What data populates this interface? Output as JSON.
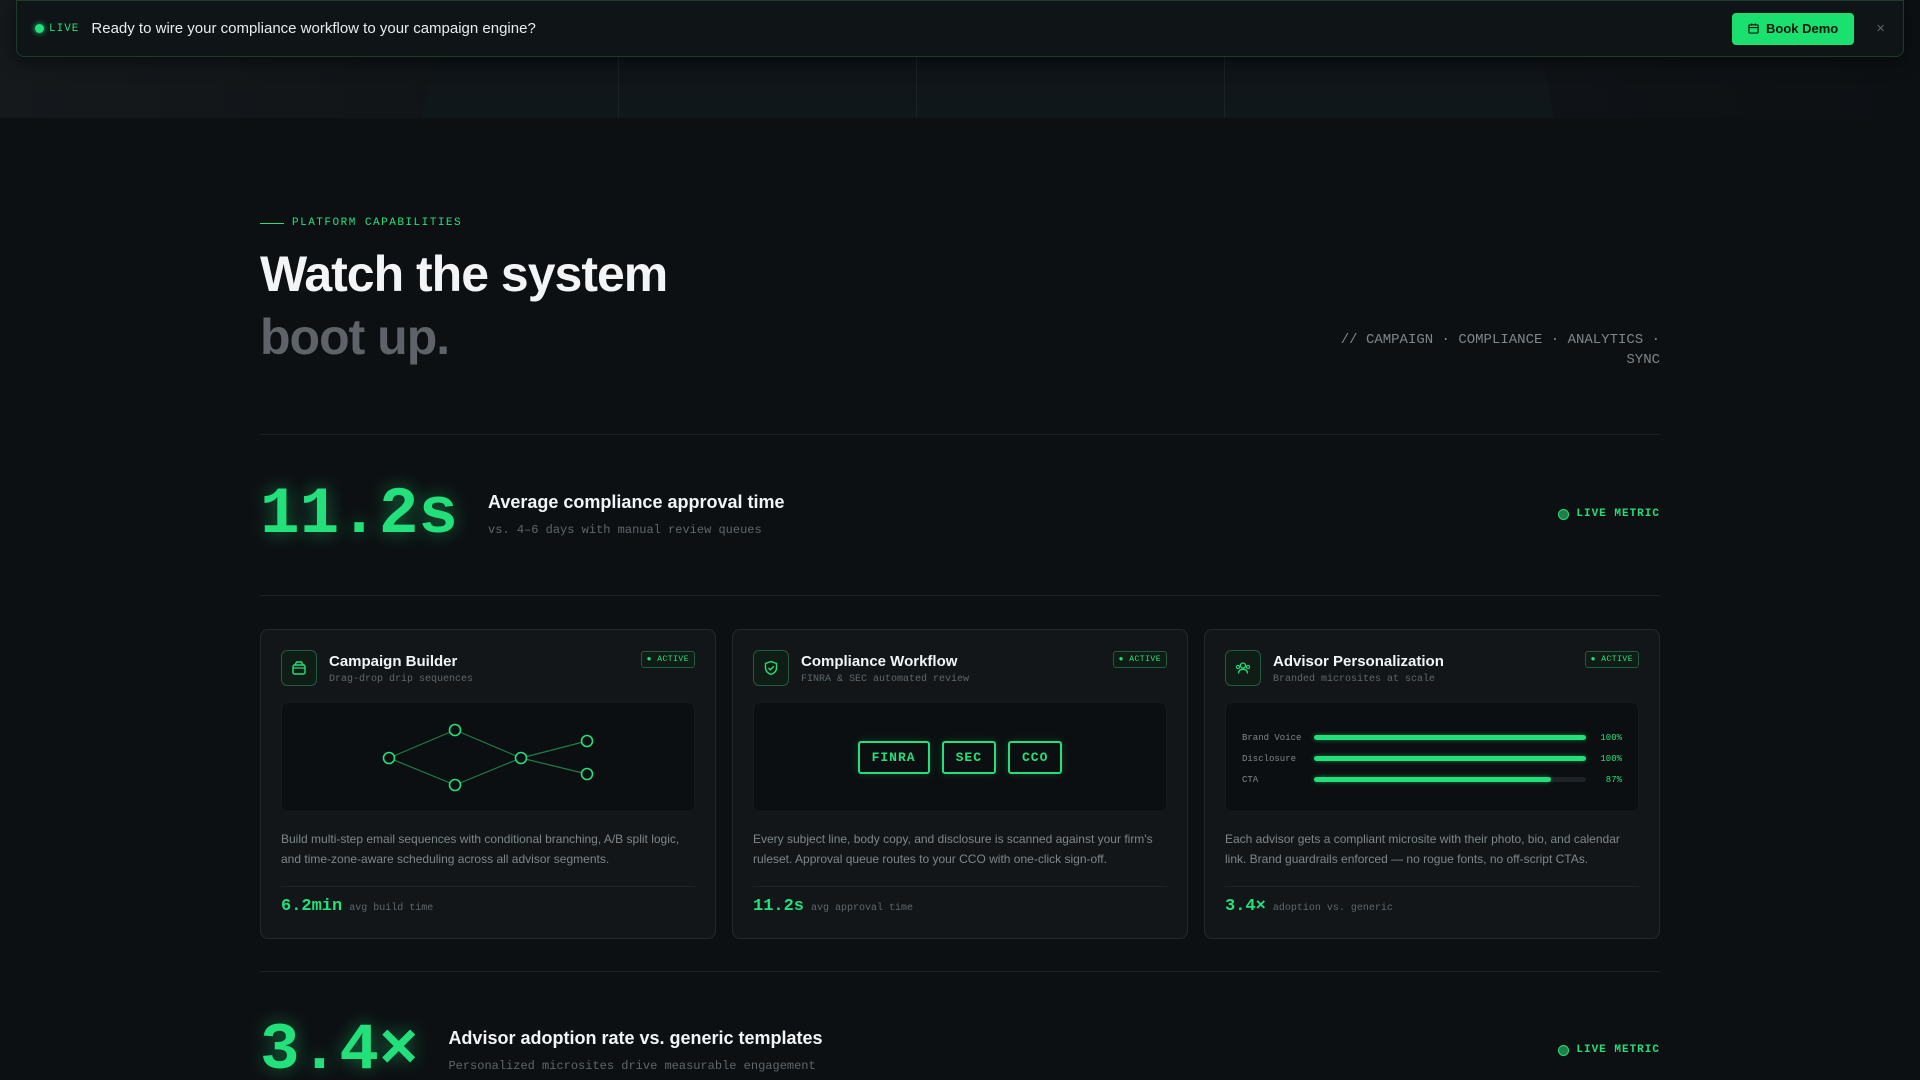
{
  "banner": {
    "live_label": "LIVE",
    "message": "Ready to wire your compliance workflow to your campaign engine?",
    "cta_label": "Book Demo",
    "close_glyph": "×"
  },
  "section": {
    "eyebrow": "PLATFORM CAPABILITIES",
    "title_line1": "Watch the system",
    "title_line2": "boot up.",
    "tagline": "// CAMPAIGN · COMPLIANCE · ANALYTICS · SYNC"
  },
  "metrics": [
    {
      "value": "11.2s",
      "title": "Average compliance approval time",
      "subtitle": "vs. 4–6 days with manual review queues",
      "live_label": "LIVE METRIC"
    },
    {
      "value": "3.4×",
      "title": "Advisor adoption rate vs. generic templates",
      "subtitle": "Personalized microsites drive measurable engagement",
      "live_label": "LIVE METRIC"
    }
  ],
  "cards": [
    {
      "icon": "box-icon",
      "title": "Campaign Builder",
      "subtitle": "Drag-drop drip sequences",
      "badge": "● ACTIVE",
      "description": "Build multi-step email sequences with conditional branching, A/B split logic, and time-zone-aware scheduling across all advisor segments.",
      "foot_value": "6.2min",
      "foot_label": "avg build time"
    },
    {
      "icon": "shield-check-icon",
      "title": "Compliance Workflow",
      "subtitle": "FINRA & SEC automated review",
      "badge": "● ACTIVE",
      "tags": [
        "FINRA",
        "SEC",
        "CCO"
      ],
      "description": "Every subject line, body copy, and disclosure is scanned against your firm's ruleset. Approval queue routes to your CCO with one-click sign-off.",
      "foot_value": "11.2s",
      "foot_label": "avg approval time"
    },
    {
      "icon": "users-icon",
      "title": "Advisor Personalization",
      "subtitle": "Branded microsites at scale",
      "badge": "● ACTIVE",
      "bars": [
        {
          "label": "Brand Voice",
          "value": 100,
          "display": "100%"
        },
        {
          "label": "Disclosure",
          "value": 100,
          "display": "100%"
        },
        {
          "label": "CTA",
          "value": 87,
          "display": "87%"
        }
      ],
      "description": "Each advisor gets a compliant microsite with their photo, bio, and calendar link. Brand guardrails enforced — no rogue fonts, no off-script CTAs.",
      "foot_value": "3.4×",
      "foot_label": "adoption vs. generic"
    }
  ],
  "colors": {
    "accent": "#22e07a",
    "background": "#0d1013",
    "card": "#121619"
  }
}
